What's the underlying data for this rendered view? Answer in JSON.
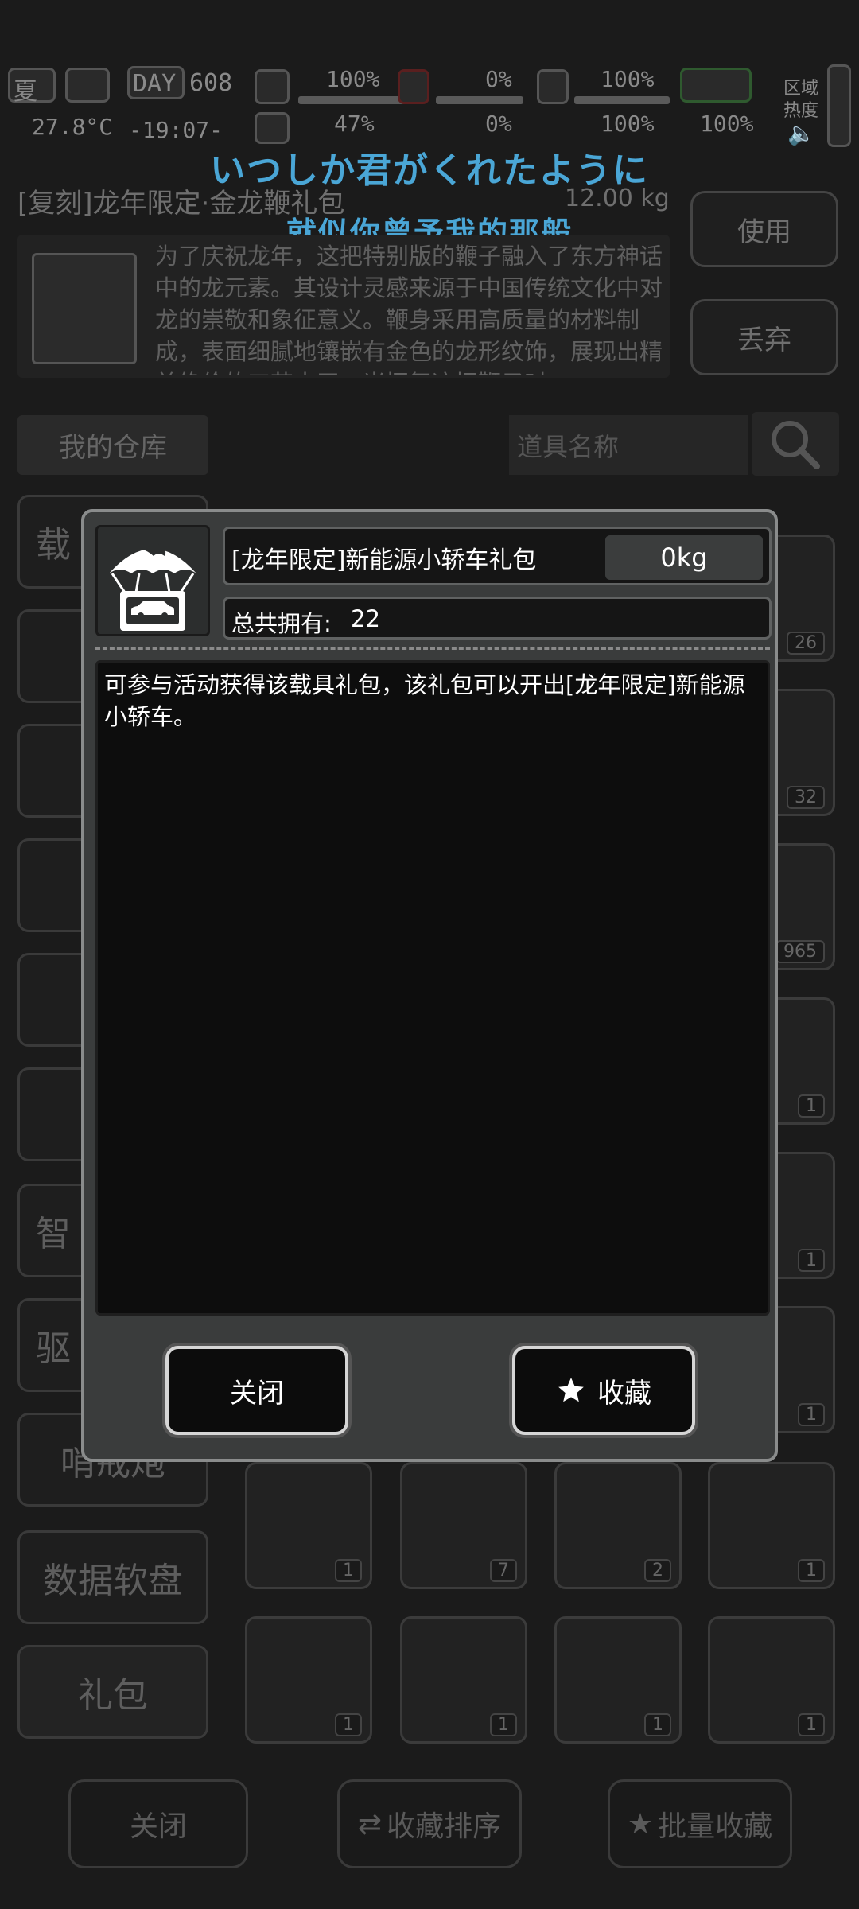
{
  "hud": {
    "season": "夏",
    "day_label": "DAY",
    "day": "608",
    "temperature": "27.8°C",
    "time": "-19:07-",
    "stat_1": "100%",
    "stat_2": "0%",
    "stat_3": "100%",
    "stat_4": "47%",
    "stat_5": "0%",
    "stat_6": "100%",
    "stat_7": "100%",
    "region_label": "区域",
    "heat_label": "热度"
  },
  "lyrics": {
    "jp": "いつしか君がくれたように",
    "cn": "就似你曾予我的那般"
  },
  "selected_item": {
    "title": "[复刻]龙年限定·金龙鞭礼包",
    "weight": "12.00 kg",
    "description": "为了庆祝龙年，这把特别版的鞭子融入了东方神话中的龙元素。其设计灵感来源于中国传统文化中对龙的崇敬和象征意义。鞭身采用高质量的材料制成，表面细腻地镶嵌有金色的龙形纹饰，展现出精美绝伦的工艺水平，当挥舞这把鞭子时"
  },
  "side_buttons": {
    "use": "使用",
    "discard": "丢弃"
  },
  "storage": {
    "tab": "我的仓库",
    "search_placeholder": "道具名称"
  },
  "categories": [
    "载",
    "智",
    "驱",
    "哨戒炮",
    "数据软盘",
    "礼包"
  ],
  "grid_counts": [
    "26",
    "32",
    "965",
    "1",
    "1",
    "1",
    "1",
    "7",
    "2",
    "1",
    "1",
    "1",
    "1",
    "1"
  ],
  "bottom_bar": {
    "close": "关闭",
    "sort": "收藏排序",
    "batch": "批量收藏"
  },
  "dialog": {
    "name": "[龙年限定]新能源小轿车礼包",
    "weight": "0kg",
    "own_label": "总共拥有:",
    "own_value": "22",
    "description": "可参与活动获得该载具礼包，该礼包可以开出[龙年限定]新能源小轿车。",
    "close_label": "关闭",
    "favorite_label": "收藏"
  }
}
